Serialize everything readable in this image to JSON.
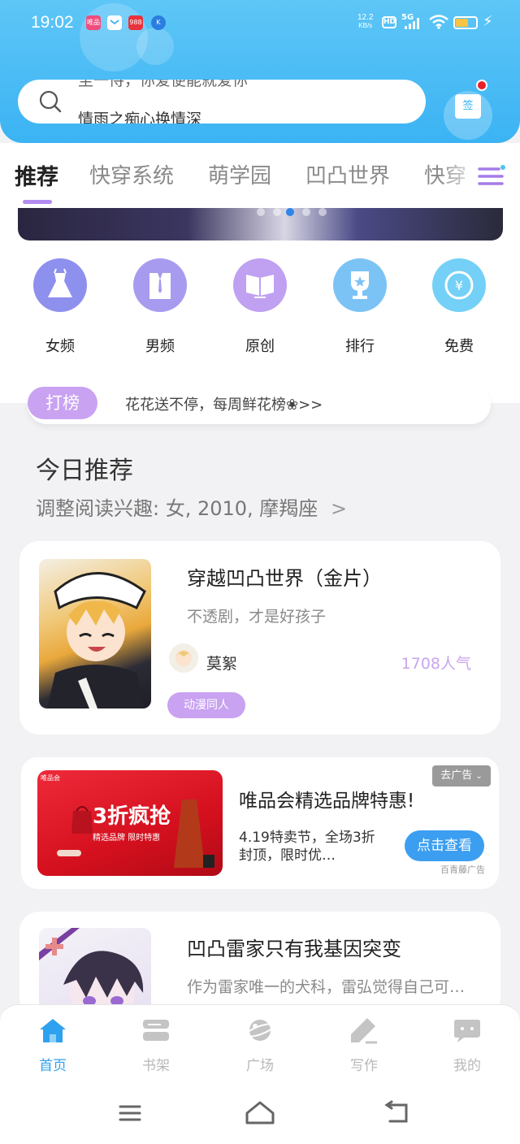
{
  "status_bar": {
    "time": "19:02",
    "network_speed": "12.2",
    "network_unit": "KB/s",
    "hd": "HD",
    "signal": "5G",
    "notif_vipshop": "唯品",
    "notif_988": "988",
    "notif_k": "K"
  },
  "search": {
    "placeholder_line1": "至一侍，你爱便能就爱你",
    "placeholder_line2": "情雨之痴心换情深"
  },
  "sign_in": {
    "label": "签"
  },
  "tabs": [
    {
      "label": "推荐"
    },
    {
      "label": "快穿系统"
    },
    {
      "label": "萌学园"
    },
    {
      "label": "凹凸世界"
    },
    {
      "label": "快穿"
    }
  ],
  "categories": [
    {
      "label": "女频",
      "icon": "dress-icon",
      "color": "#8e90ee"
    },
    {
      "label": "男频",
      "icon": "shirt-icon",
      "color": "#a79bf0"
    },
    {
      "label": "原创",
      "icon": "book-icon",
      "color": "#bfa0f1"
    },
    {
      "label": "排行",
      "icon": "trophy-icon",
      "color": "#7cc3f5"
    },
    {
      "label": "免费",
      "icon": "yuan-icon",
      "color": "#74d0f6"
    }
  ],
  "rank": {
    "badge": "打榜",
    "text": "花花送不停，每周鲜花榜❀>>"
  },
  "today": {
    "title": "今日推荐",
    "subtitle": "调整阅读兴趣: 女, 2010, 摩羯座",
    "chevron": ">"
  },
  "books": [
    {
      "title": "穿越凹凸世界（金片）",
      "desc": "不透剧，才是好孩子",
      "author": "莫絮",
      "popularity": "1708人气",
      "tag": "动漫同人"
    },
    {
      "title": "凹凸雷家只有我基因突变",
      "desc": "作为雷家唯一的犬科，雷弘觉得自己可…"
    }
  ],
  "ad": {
    "close_label": "去广告",
    "title": "唯品会精选品牌特惠!",
    "desc": "4.19特卖节，全场3折封顶，限时优…",
    "button": "点击查看",
    "source": "百青藤广告",
    "image_text": "3折疯抢",
    "image_sub": "精选品牌  限时特惠",
    "image_logo": "唯品会"
  },
  "bottom_nav": [
    {
      "label": "首页",
      "icon": "home-icon",
      "active": true
    },
    {
      "label": "书架",
      "icon": "bookshelf-icon",
      "active": false
    },
    {
      "label": "广场",
      "icon": "planet-icon",
      "active": false
    },
    {
      "label": "写作",
      "icon": "pen-icon",
      "active": false
    },
    {
      "label": "我的",
      "icon": "chat-bubble-icon",
      "active": false
    }
  ]
}
